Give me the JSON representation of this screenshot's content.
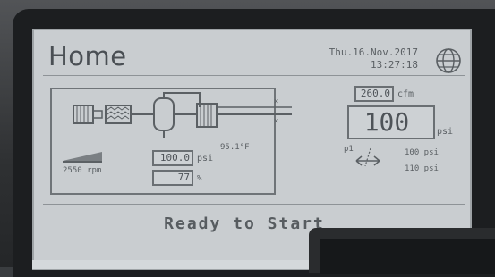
{
  "screen": {
    "title": "Home",
    "date": "Thu.16.Nov.2017",
    "time": "13:27:18"
  },
  "readings": {
    "temperature": "95.1°F",
    "rpm_label": "2550 rpm",
    "pressure_value": "100.0",
    "pressure_unit": "psi",
    "percent_value": "77",
    "percent_unit": "%",
    "flow_value": "260.0",
    "flow_unit": "cfm",
    "main_pressure": "100",
    "main_pressure_unit": "psi",
    "p1_label": "p1",
    "p_low": "100 psi",
    "p_high": "110 psi"
  },
  "status_text": "Ready to Start",
  "icons": [
    "globe-icon",
    "motor-icon",
    "filter-icon",
    "separator-icon",
    "cooler-icon",
    "speed-ramp-icon",
    "pressure-range-icon"
  ]
}
